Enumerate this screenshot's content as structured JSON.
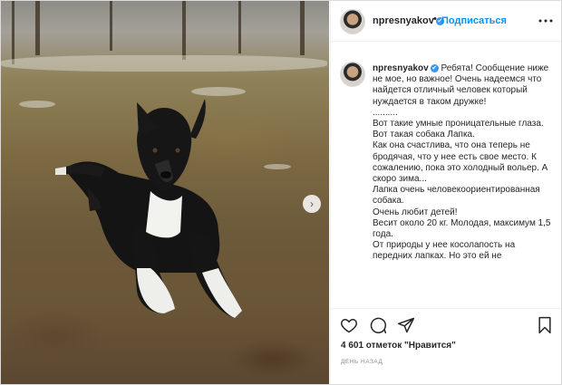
{
  "post": {
    "username": "npresnyakov",
    "verified_mark": "✔",
    "header_separator": "•",
    "follow_label": "Подписаться",
    "more_icon": "more-horizontal-icon",
    "caption_lines": [
      "Ребята! Сообщение ниже не мое, но важное! Очень надеемся что найдется отличный человек который нуждается в таком дружке!",
      "..........",
      "Вот такие умные проницательные глаза. Вот такая собака Лапка.",
      "Как она счастлива, что она теперь не бродячая, что у нее есть свое место. К сожалению, пока это холодный вольер. А скоро зима...",
      "Лапка очень человекоориентированная собака.",
      "Очень любит детей!",
      "Весит около 20 кг. Молодая, максимум 1,5 года.",
      "От природы у нее косолапость на передних лапках. Но это ей не"
    ],
    "likes": "4 601 отметок \"Нравится\"",
    "time": "день назад",
    "next_arrow": "›"
  },
  "colors": {
    "accent": "#0095f6",
    "verified": "#3897f0",
    "text": "#262626",
    "secondary": "#8e8e8e",
    "border": "#dbdbdb"
  },
  "icons": [
    "heart-icon",
    "comment-icon",
    "share-icon",
    "bookmark-icon",
    "chevron-right-icon"
  ]
}
